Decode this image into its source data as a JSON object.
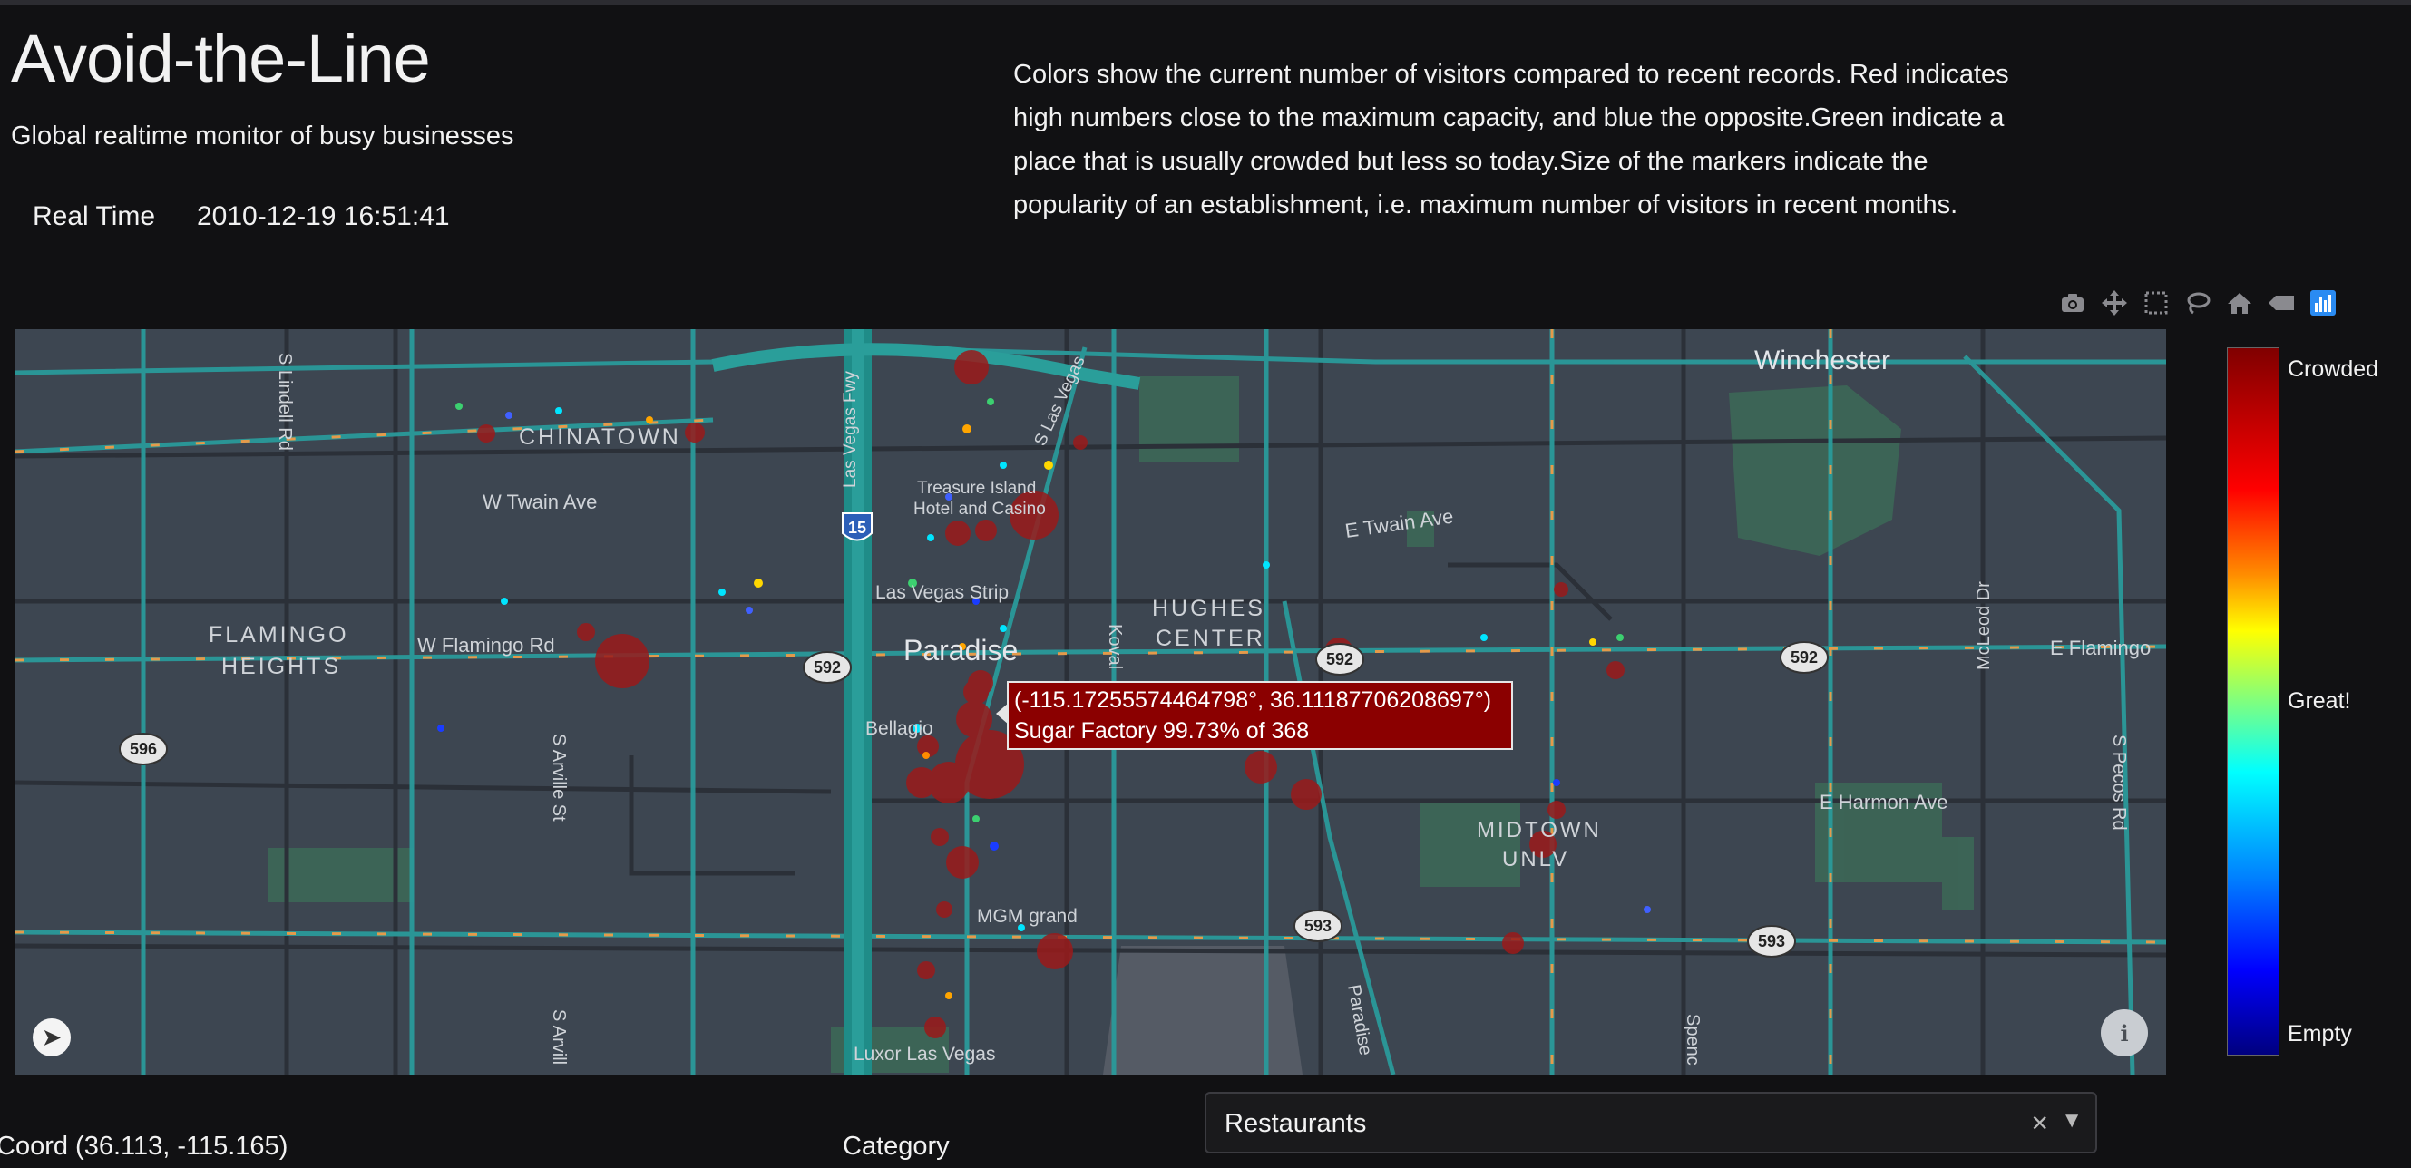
{
  "header": {
    "title": "Avoid-the-Line",
    "subtitle": "Global realtime monitor of busy businesses",
    "realtime_label": "Real Time",
    "realtime_value": "2010-12-19 16:51:41"
  },
  "description": "Colors show the current number of visitors compared to recent records. Red indicates high numbers close to the maximum capacity, and blue the opposite.Green indicate a place that is usually crowded but less so today.Size of the markers indicate the popularity of an establishment, i.e. maximum number of visitors in recent months.",
  "modebar": {
    "icons": [
      "camera-icon",
      "pan-icon",
      "box-select-icon",
      "lasso-icon",
      "home-icon",
      "hover-closest-icon",
      "plotly-logo-icon"
    ]
  },
  "map": {
    "labels": {
      "winchester": "Winchester",
      "chinatown": "CHINATOWN",
      "w_twain": "W Twain Ave",
      "e_twain": "E Twain Ave",
      "flamingo_heights_1": "FLAMINGO",
      "flamingo_heights_2": "HEIGHTS",
      "w_flamingo": "W Flamingo Rd",
      "e_flamingo": "E Flamingo",
      "hughes_1": "HUGHES",
      "hughes_2": "CENTER",
      "paradise": "Paradise",
      "bellagio": "Bellagio",
      "treasure_1": "Treasure Island",
      "treasure_2": "Hotel and Casino",
      "lv_strip": "Las Vegas Strip",
      "lv_fwy": "Las Vegas Fwy",
      "lv_blvd": "S Las Vegas",
      "mgm": "MGM grand",
      "luxor": "Luxor Las Vegas",
      "midtown_1": "MIDTOWN",
      "midtown_2": "UNLV",
      "e_harmon": "E Harmon Ave",
      "lindell": "S Lindell Rd",
      "arville": "S Arville St",
      "arville2": "S Arvill",
      "koval": "Koval",
      "mcleod": "McLeod Dr",
      "pecos": "S Pecos Rd",
      "paradise_rd": "Paradise",
      "spencer": "Spenc",
      "shield_15": "15",
      "shield_592a": "592",
      "shield_592b": "592",
      "shield_592c": "592",
      "shield_593a": "593",
      "shield_593b": "593",
      "shield_596": "596"
    },
    "tooltip": {
      "coords": "(-115.17255574464798°, 36.11187706208697°)",
      "text": "Sugar Factory 99.73% of 368"
    }
  },
  "colorbar": {
    "top": "Crowded",
    "middle": "Great!",
    "bottom": "Empty",
    "colors": [
      "#800000",
      "#ff0000",
      "#ff8c00",
      "#ffff00",
      "#7fff7f",
      "#00ffff",
      "#0080ff",
      "#0000ff",
      "#00007f"
    ]
  },
  "footer": {
    "coord": "Coord (36.113, -115.165)",
    "category_label": "Category",
    "category_value": "Restaurants"
  }
}
